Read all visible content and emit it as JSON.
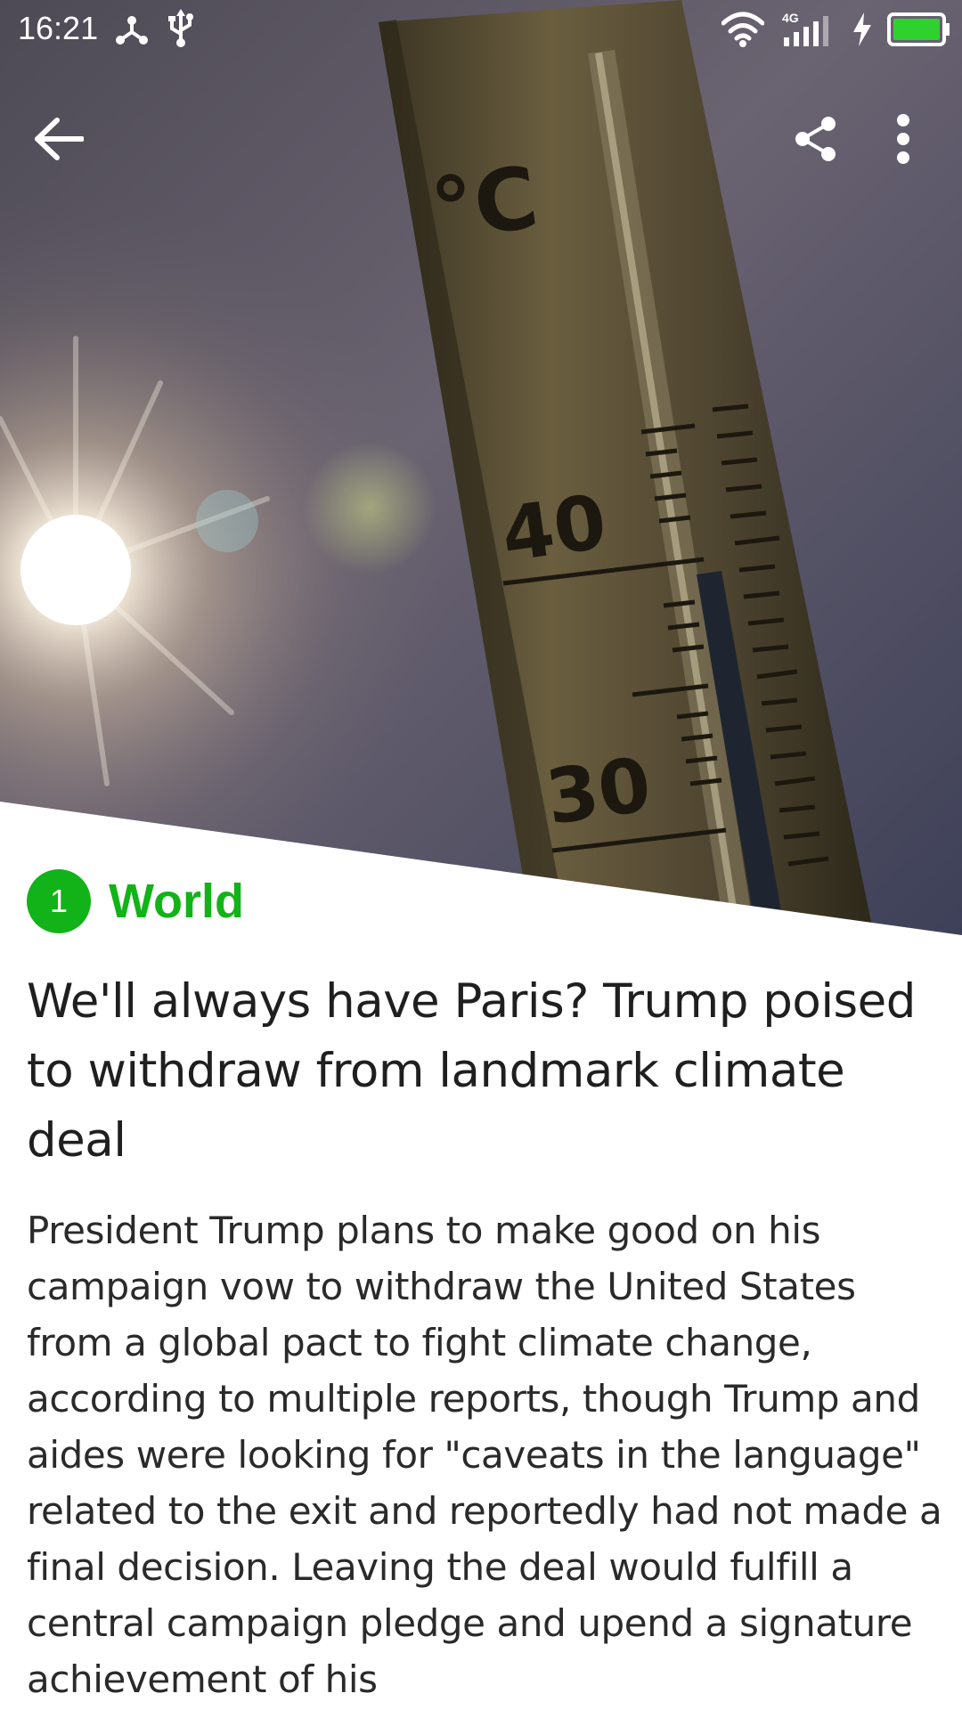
{
  "status_bar": {
    "time": "16:21",
    "network_type": "4G",
    "icons": [
      "share-hub-icon",
      "usb-icon",
      "wifi-icon",
      "cellular-signal-icon",
      "charging-icon",
      "battery-icon"
    ]
  },
  "toolbar": {
    "back_icon": "arrow-left-icon",
    "share_icon": "share-icon",
    "more_icon": "more-vertical-icon"
  },
  "hero_image": {
    "thermometer_unit": "°C",
    "scale_labels": [
      "40",
      "30"
    ]
  },
  "article": {
    "rank": "1",
    "category": "World",
    "headline": "We'll always have Paris? Trump poised to withdraw from landmark climate deal",
    "body": "President Trump plans to make good on his campaign vow to withdraw the United States from a global pact to fight climate change, according to multiple reports, though Trump and aides were looking for \"caveats in the language\" related to the exit and reportedly had not made a final decision. Leaving the deal would fulfill a central campaign pledge and upend a signature achievement of his"
  },
  "colors": {
    "accent": "#12b318",
    "headline_text": "#1f1f1f",
    "body_text": "#2a2a2a",
    "battery_fill": "#2fd12f"
  }
}
